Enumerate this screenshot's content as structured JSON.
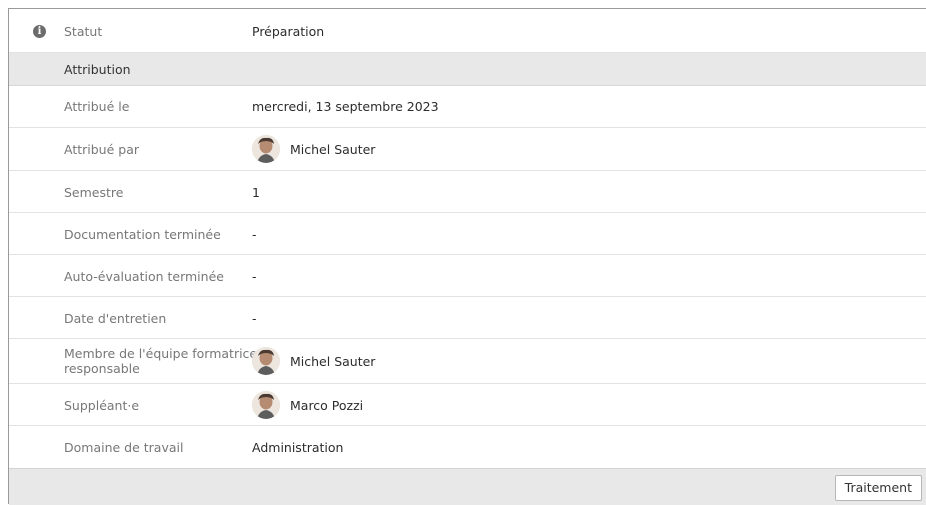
{
  "status": {
    "label": "Statut",
    "value": "Préparation",
    "icon": "info-icon"
  },
  "section": {
    "title": "Attribution"
  },
  "fields": {
    "assigned_on": {
      "label": "Attribué le",
      "value": "mercredi, 13 septembre 2023"
    },
    "assigned_by": {
      "label": "Attribué par",
      "value": "Michel Sauter"
    },
    "semester": {
      "label": "Semestre",
      "value": "1"
    },
    "documentation_done": {
      "label": "Documentation terminée",
      "value": "-"
    },
    "self_eval_done": {
      "label": "Auto-évaluation terminée",
      "value": "-"
    },
    "interview_date": {
      "label": "Date d'entretien",
      "value": "-"
    },
    "responsible_member": {
      "label_line1": "Membre de l'équipe formatrice",
      "label_line2": "responsable",
      "value": "Michel Sauter"
    },
    "substitute": {
      "label": "Suppléant·e",
      "value": "Marco Pozzi"
    },
    "work_domain": {
      "label": "Domaine de travail",
      "value": "Administration"
    }
  },
  "footer": {
    "button_label": "Traitement"
  }
}
